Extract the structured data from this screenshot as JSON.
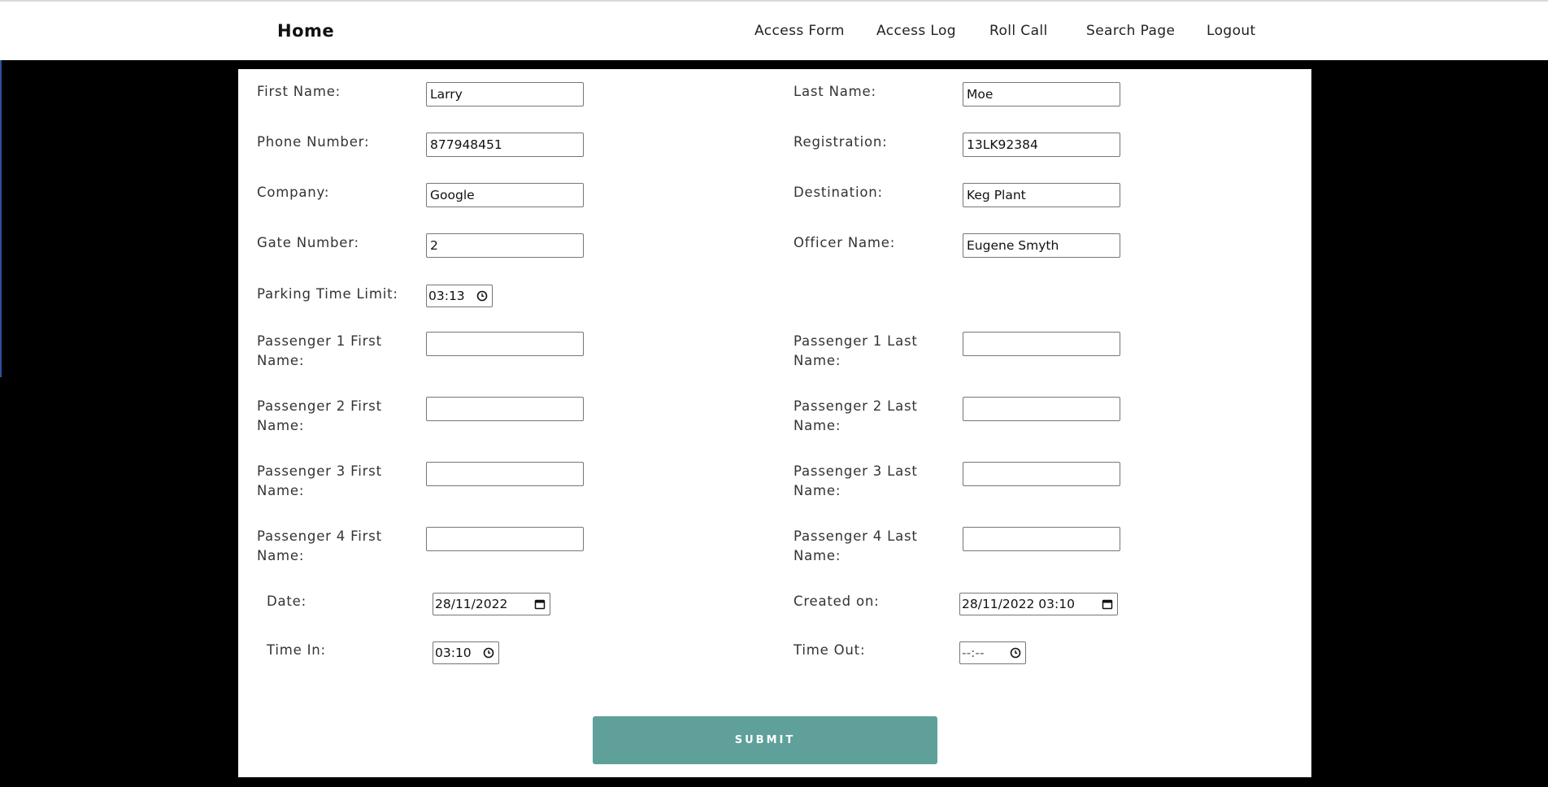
{
  "nav": {
    "brand": "Home",
    "links": [
      "Access Form",
      "Access Log",
      "Roll Call",
      "Search Page",
      "Logout"
    ]
  },
  "form": {
    "first_name": {
      "label": "First Name:",
      "value": "Larry"
    },
    "last_name": {
      "label": "Last Name:",
      "value": "Moe"
    },
    "phone": {
      "label": "Phone Number:",
      "value": "877948451"
    },
    "registration": {
      "label": "Registration:",
      "value": "13LK92384"
    },
    "company": {
      "label": "Company:",
      "value": "Google"
    },
    "destination": {
      "label": "Destination:",
      "value": "Keg Plant"
    },
    "gate": {
      "label": "Gate Number:",
      "value": "2"
    },
    "officer": {
      "label": "Officer Name:",
      "value": "Eugene Smyth"
    },
    "parking": {
      "label": "Parking Time Limit:",
      "value": "03:13"
    },
    "passengers": [
      {
        "first_label": "Passenger 1 First Name:",
        "last_label": "Passenger 1 Last Name:",
        "first": "",
        "last": ""
      },
      {
        "first_label": "Passenger 2 First Name:",
        "last_label": "Passenger 2 Last Name:",
        "first": "",
        "last": ""
      },
      {
        "first_label": "Passenger 3 First Name:",
        "last_label": "Passenger 3 Last Name:",
        "first": "",
        "last": ""
      },
      {
        "first_label": "Passenger 4 First Name:",
        "last_label": "Passenger 4 Last Name:",
        "first": "",
        "last": ""
      }
    ],
    "date": {
      "label": "Date:",
      "value": "28/11/2022"
    },
    "created_on": {
      "label": "Created on:",
      "value": "28/11/2022 03:10"
    },
    "time_in": {
      "label": "Time In:",
      "value": "03:10"
    },
    "time_out": {
      "label": "Time Out:",
      "value": "--:--"
    },
    "submit_label": "SUBMIT"
  },
  "icons": {
    "clock": "clock-icon",
    "calendar": "calendar-icon"
  },
  "colors": {
    "submit": "#5fa09a",
    "background": "#000000"
  }
}
